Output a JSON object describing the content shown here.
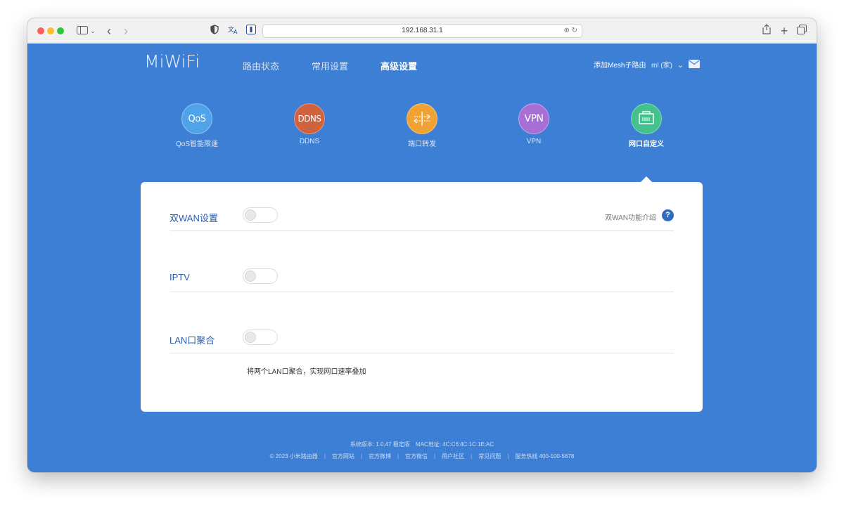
{
  "browser": {
    "url": "192.168.31.1"
  },
  "header": {
    "logo": "MiWiFi",
    "nav": [
      {
        "label": "路由状态"
      },
      {
        "label": "常用设置"
      },
      {
        "label": "高级设置"
      }
    ],
    "add_mesh": "添加Mesh子路由",
    "user": "ml (家)"
  },
  "features": [
    {
      "icon_text": "QoS",
      "label": "QoS智能限速",
      "color": "#4fa3e8"
    },
    {
      "icon_text": "DDNS",
      "label": "DDNS",
      "color": "#d0623d"
    },
    {
      "icon_text": "",
      "label": "端口转发",
      "color": "#f0a232"
    },
    {
      "icon_text": "VPN",
      "label": "VPN",
      "color": "#a76fd6"
    },
    {
      "icon_text": "",
      "label": "网口自定义",
      "color": "#43c28e"
    }
  ],
  "settings": [
    {
      "label": "双WAN设置",
      "help": "双WAN功能介绍",
      "help_icon": "?"
    },
    {
      "label": "IPTV"
    },
    {
      "label": "LAN口聚合",
      "desc": "将两个LAN口聚合，实现网口速率叠加"
    }
  ],
  "footer": {
    "version": "系统版本: 1.0.47 稳定版",
    "mac": "MAC地址: 4C:C6:4C:1C:1E:AC",
    "links": [
      "© 2023 小米路由器",
      "官方网站",
      "官方微博",
      "官方微信",
      "用户社区",
      "常见问题",
      "服务热线 400-100-5678"
    ]
  }
}
